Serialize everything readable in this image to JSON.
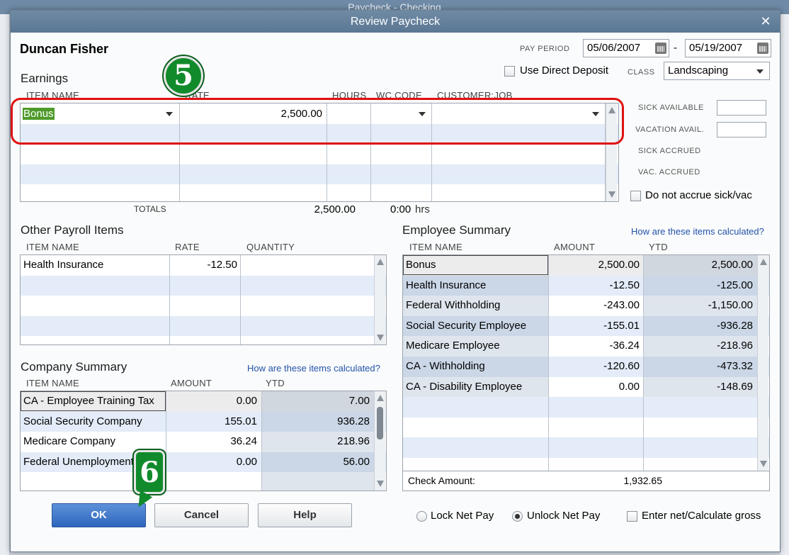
{
  "background_window": {
    "title": "Paycheck - Checking"
  },
  "dialog": {
    "title": "Review Paycheck",
    "employee_name": "Duncan Fisher",
    "pay_period_label": "PAY PERIOD",
    "pay_period_start": "05/06/2007",
    "pay_period_sep": "-",
    "pay_period_end": "05/19/2007",
    "direct_deposit_label": "Use Direct Deposit",
    "class_label": "CLASS",
    "class_value": "Landscaping"
  },
  "earnings": {
    "title": "Earnings",
    "headers": [
      "ITEM NAME",
      "RATE",
      "HOURS",
      "WC CODE",
      "CUSTOMER:JOB"
    ],
    "rows": [
      {
        "item": "Bonus",
        "rate": "2,500.00",
        "hours": "",
        "wc": "",
        "customer": ""
      }
    ],
    "totals_label": "TOTALS",
    "totals_amount": "2,500.00",
    "totals_hours": "0:00",
    "hrs_label": "hrs"
  },
  "sick_vac": {
    "sick_available": "SICK AVAILABLE",
    "vacation_avail": "VACATION AVAIL.",
    "sick_accrued": "SICK ACCRUED",
    "vac_accrued": "VAC. ACCRUED",
    "no_accrue_label": "Do not accrue sick/vac"
  },
  "other_payroll": {
    "title": "Other Payroll Items",
    "headers": [
      "ITEM NAME",
      "RATE",
      "QUANTITY"
    ],
    "rows": [
      {
        "item": "Health Insurance",
        "rate": "-12.50",
        "qty": ""
      }
    ]
  },
  "employee_summary": {
    "title": "Employee Summary",
    "link": "How are these items calculated?",
    "headers": [
      "ITEM NAME",
      "AMOUNT",
      "YTD"
    ],
    "rows": [
      {
        "item": "Bonus",
        "amount": "2,500.00",
        "ytd": "2,500.00"
      },
      {
        "item": "Health Insurance",
        "amount": "-12.50",
        "ytd": "-125.00"
      },
      {
        "item": "Federal Withholding",
        "amount": "-243.00",
        "ytd": "-1,150.00"
      },
      {
        "item": "Social Security Employee",
        "amount": "-155.01",
        "ytd": "-936.28"
      },
      {
        "item": "Medicare Employee",
        "amount": "-36.24",
        "ytd": "-218.96"
      },
      {
        "item": "CA - Withholding",
        "amount": "-120.60",
        "ytd": "-473.32"
      },
      {
        "item": "CA - Disability Employee",
        "amount": "0.00",
        "ytd": "-148.69"
      }
    ],
    "check_amount_label": "Check Amount:",
    "check_amount": "1,932.65"
  },
  "company_summary": {
    "title": "Company Summary",
    "link": "How are these items calculated?",
    "headers": [
      "ITEM NAME",
      "AMOUNT",
      "YTD"
    ],
    "rows": [
      {
        "item": "CA - Employee Training Tax",
        "amount": "0.00",
        "ytd": "7.00"
      },
      {
        "item": "Social Security Company",
        "amount": "155.01",
        "ytd": "936.28"
      },
      {
        "item": "Medicare Company",
        "amount": "36.24",
        "ytd": "218.96"
      },
      {
        "item": "Federal Unemployment",
        "amount": "0.00",
        "ytd": "56.00"
      }
    ]
  },
  "buttons": {
    "ok": "OK",
    "cancel": "Cancel",
    "help": "Help"
  },
  "options": {
    "lock_net_pay": "Lock Net Pay",
    "unlock_net_pay": "Unlock Net Pay",
    "enter_net": "Enter net/Calculate gross"
  },
  "callouts": {
    "step5": "5",
    "step6": "6"
  },
  "colors": {
    "highlight_red": "#e01010",
    "callout_green": "#118a2c",
    "ok_blue": "#2f66bd"
  }
}
